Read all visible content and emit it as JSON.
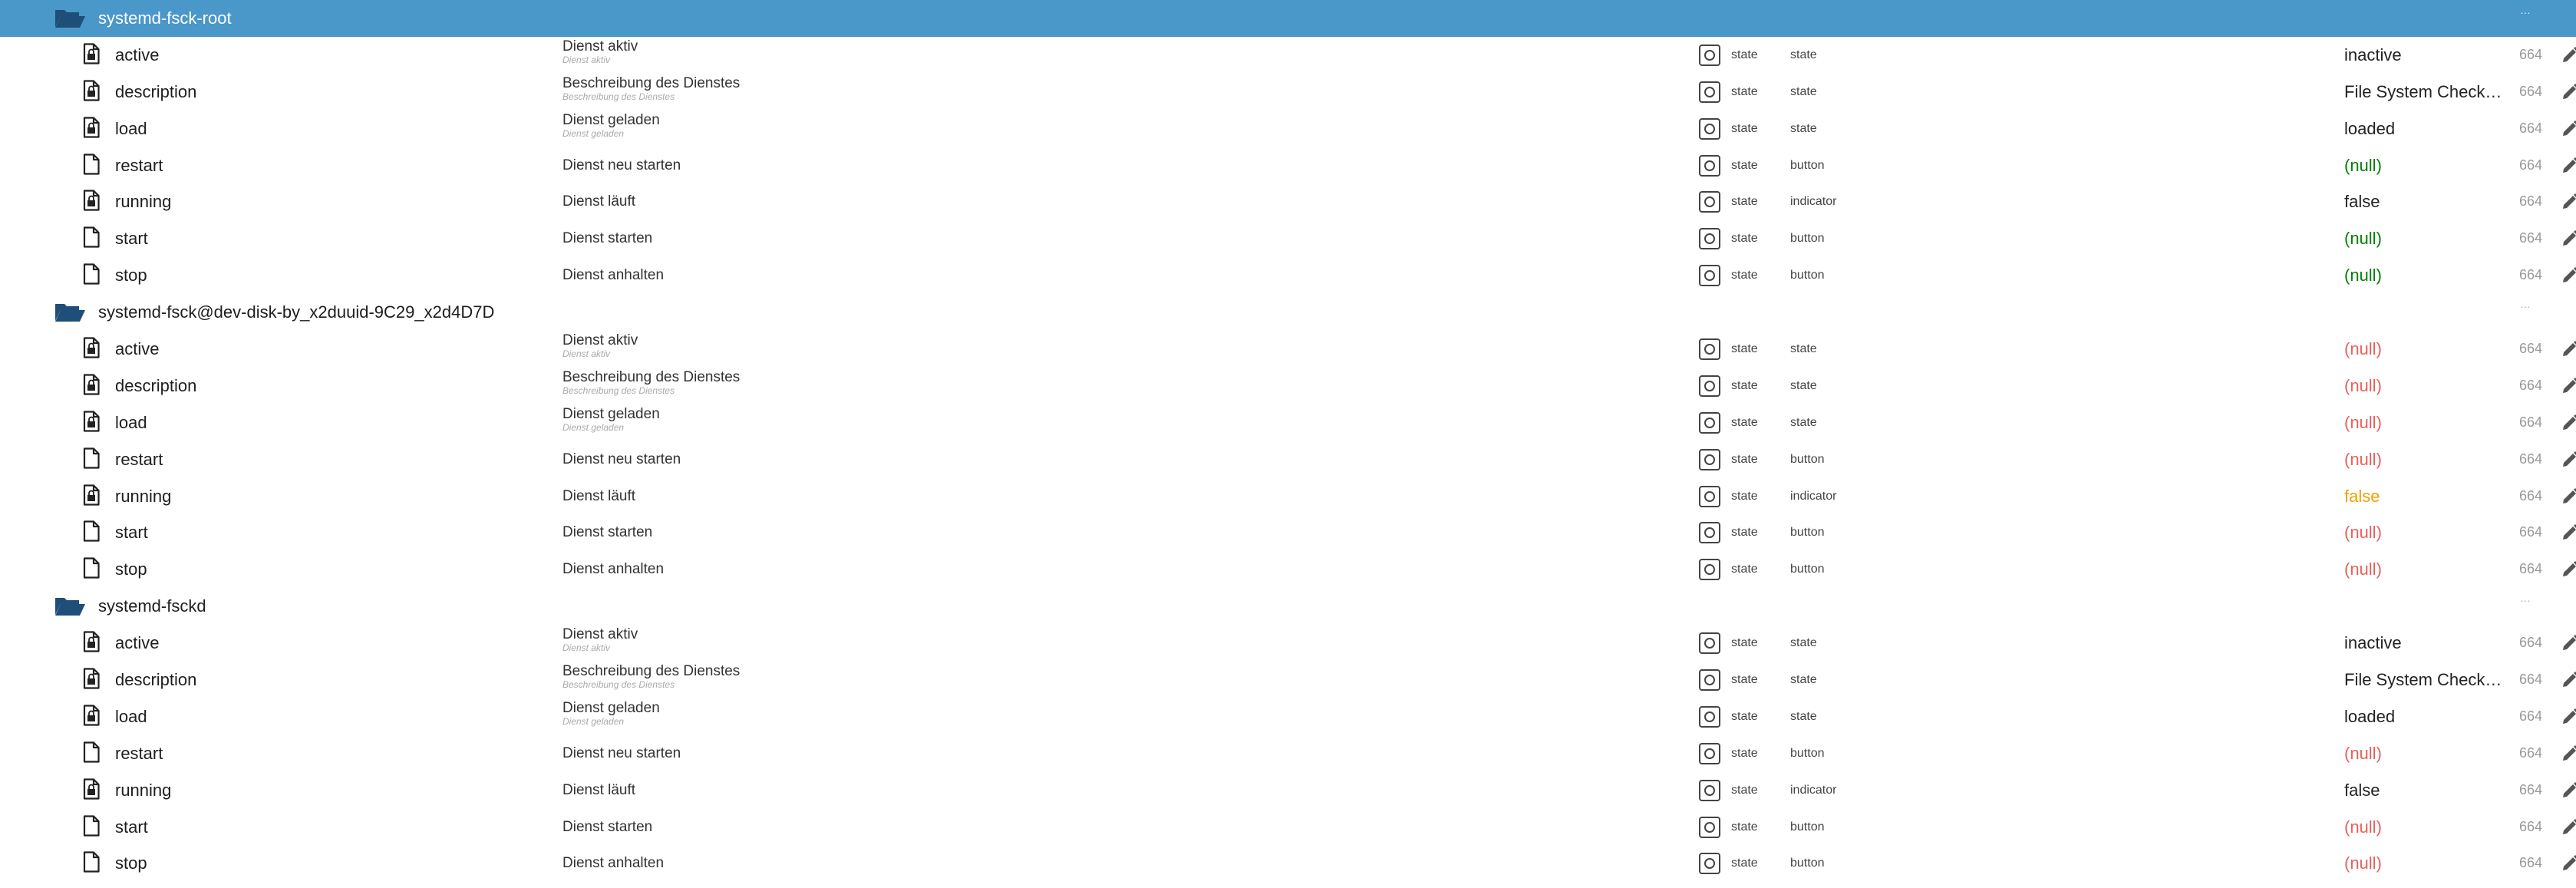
{
  "colors": {
    "selected_bg": "#4a97c9",
    "folder_icon": "#1f4e79",
    "value_green": "#008000",
    "value_red": "#e8605a",
    "value_orange": "#f0a000"
  },
  "groups": [
    {
      "name": "systemd-fsck-root",
      "selected": true,
      "dots": "…",
      "rows": [
        {
          "name": "active",
          "icon": "file-locked-icon",
          "desc": "Dienst aktiv",
          "desc_sub": "Dienst aktiv",
          "type": "state",
          "role": "state",
          "value": "inactive",
          "value_color": "dark",
          "acl": "664"
        },
        {
          "name": "description",
          "icon": "file-locked-icon",
          "desc": "Beschreibung des Dienstes",
          "desc_sub": "Beschreibung des Dienstes",
          "type": "state",
          "role": "state",
          "value": "File System Check…",
          "value_color": "dark",
          "acl": "664"
        },
        {
          "name": "load",
          "icon": "file-locked-icon",
          "desc": "Dienst geladen",
          "desc_sub": "Dienst geladen",
          "type": "state",
          "role": "state",
          "value": "loaded",
          "value_color": "dark",
          "acl": "664"
        },
        {
          "name": "restart",
          "icon": "file-icon",
          "desc": "Dienst neu starten",
          "desc_sub": "",
          "type": "state",
          "role": "button",
          "value": "(null)",
          "value_color": "green",
          "acl": "664"
        },
        {
          "name": "running",
          "icon": "file-locked-icon",
          "desc": "Dienst läuft",
          "desc_sub": "",
          "type": "state",
          "role": "indicator",
          "value": "false",
          "value_color": "dark",
          "acl": "664"
        },
        {
          "name": "start",
          "icon": "file-icon",
          "desc": "Dienst starten",
          "desc_sub": "",
          "type": "state",
          "role": "button",
          "value": "(null)",
          "value_color": "green",
          "acl": "664"
        },
        {
          "name": "stop",
          "icon": "file-icon",
          "desc": "Dienst anhalten",
          "desc_sub": "",
          "type": "state",
          "role": "button",
          "value": "(null)",
          "value_color": "green",
          "acl": "664"
        }
      ]
    },
    {
      "name": "systemd-fsck@dev-disk-by_x2duuid-9C29_x2d4D7D",
      "selected": false,
      "dots": "…",
      "rows": [
        {
          "name": "active",
          "icon": "file-locked-icon",
          "desc": "Dienst aktiv",
          "desc_sub": "Dienst aktiv",
          "type": "state",
          "role": "state",
          "value": "(null)",
          "value_color": "red",
          "acl": "664"
        },
        {
          "name": "description",
          "icon": "file-locked-icon",
          "desc": "Beschreibung des Dienstes",
          "desc_sub": "Beschreibung des Dienstes",
          "type": "state",
          "role": "state",
          "value": "(null)",
          "value_color": "red",
          "acl": "664"
        },
        {
          "name": "load",
          "icon": "file-locked-icon",
          "desc": "Dienst geladen",
          "desc_sub": "Dienst geladen",
          "type": "state",
          "role": "state",
          "value": "(null)",
          "value_color": "red",
          "acl": "664"
        },
        {
          "name": "restart",
          "icon": "file-icon",
          "desc": "Dienst neu starten",
          "desc_sub": "",
          "type": "state",
          "role": "button",
          "value": "(null)",
          "value_color": "red",
          "acl": "664"
        },
        {
          "name": "running",
          "icon": "file-locked-icon",
          "desc": "Dienst läuft",
          "desc_sub": "",
          "type": "state",
          "role": "indicator",
          "value": "false",
          "value_color": "orange",
          "acl": "664"
        },
        {
          "name": "start",
          "icon": "file-icon",
          "desc": "Dienst starten",
          "desc_sub": "",
          "type": "state",
          "role": "button",
          "value": "(null)",
          "value_color": "red",
          "acl": "664"
        },
        {
          "name": "stop",
          "icon": "file-icon",
          "desc": "Dienst anhalten",
          "desc_sub": "",
          "type": "state",
          "role": "button",
          "value": "(null)",
          "value_color": "red",
          "acl": "664"
        }
      ]
    },
    {
      "name": "systemd-fsckd",
      "selected": false,
      "dots": "…",
      "rows": [
        {
          "name": "active",
          "icon": "file-locked-icon",
          "desc": "Dienst aktiv",
          "desc_sub": "Dienst aktiv",
          "type": "state",
          "role": "state",
          "value": "inactive",
          "value_color": "dark",
          "acl": "664"
        },
        {
          "name": "description",
          "icon": "file-locked-icon",
          "desc": "Beschreibung des Dienstes",
          "desc_sub": "Beschreibung des Dienstes",
          "type": "state",
          "role": "state",
          "value": "File System Check…",
          "value_color": "dark",
          "acl": "664"
        },
        {
          "name": "load",
          "icon": "file-locked-icon",
          "desc": "Dienst geladen",
          "desc_sub": "Dienst geladen",
          "type": "state",
          "role": "state",
          "value": "loaded",
          "value_color": "dark",
          "acl": "664"
        },
        {
          "name": "restart",
          "icon": "file-icon",
          "desc": "Dienst neu starten",
          "desc_sub": "",
          "type": "state",
          "role": "button",
          "value": "(null)",
          "value_color": "red",
          "acl": "664"
        },
        {
          "name": "running",
          "icon": "file-locked-icon",
          "desc": "Dienst läuft",
          "desc_sub": "",
          "type": "state",
          "role": "indicator",
          "value": "false",
          "value_color": "dark",
          "acl": "664"
        },
        {
          "name": "start",
          "icon": "file-icon",
          "desc": "Dienst starten",
          "desc_sub": "",
          "type": "state",
          "role": "button",
          "value": "(null)",
          "value_color": "red",
          "acl": "664"
        },
        {
          "name": "stop",
          "icon": "file-icon",
          "desc": "Dienst anhalten",
          "desc_sub": "",
          "type": "state",
          "role": "button",
          "value": "(null)",
          "value_color": "red",
          "acl": "664"
        }
      ]
    }
  ]
}
